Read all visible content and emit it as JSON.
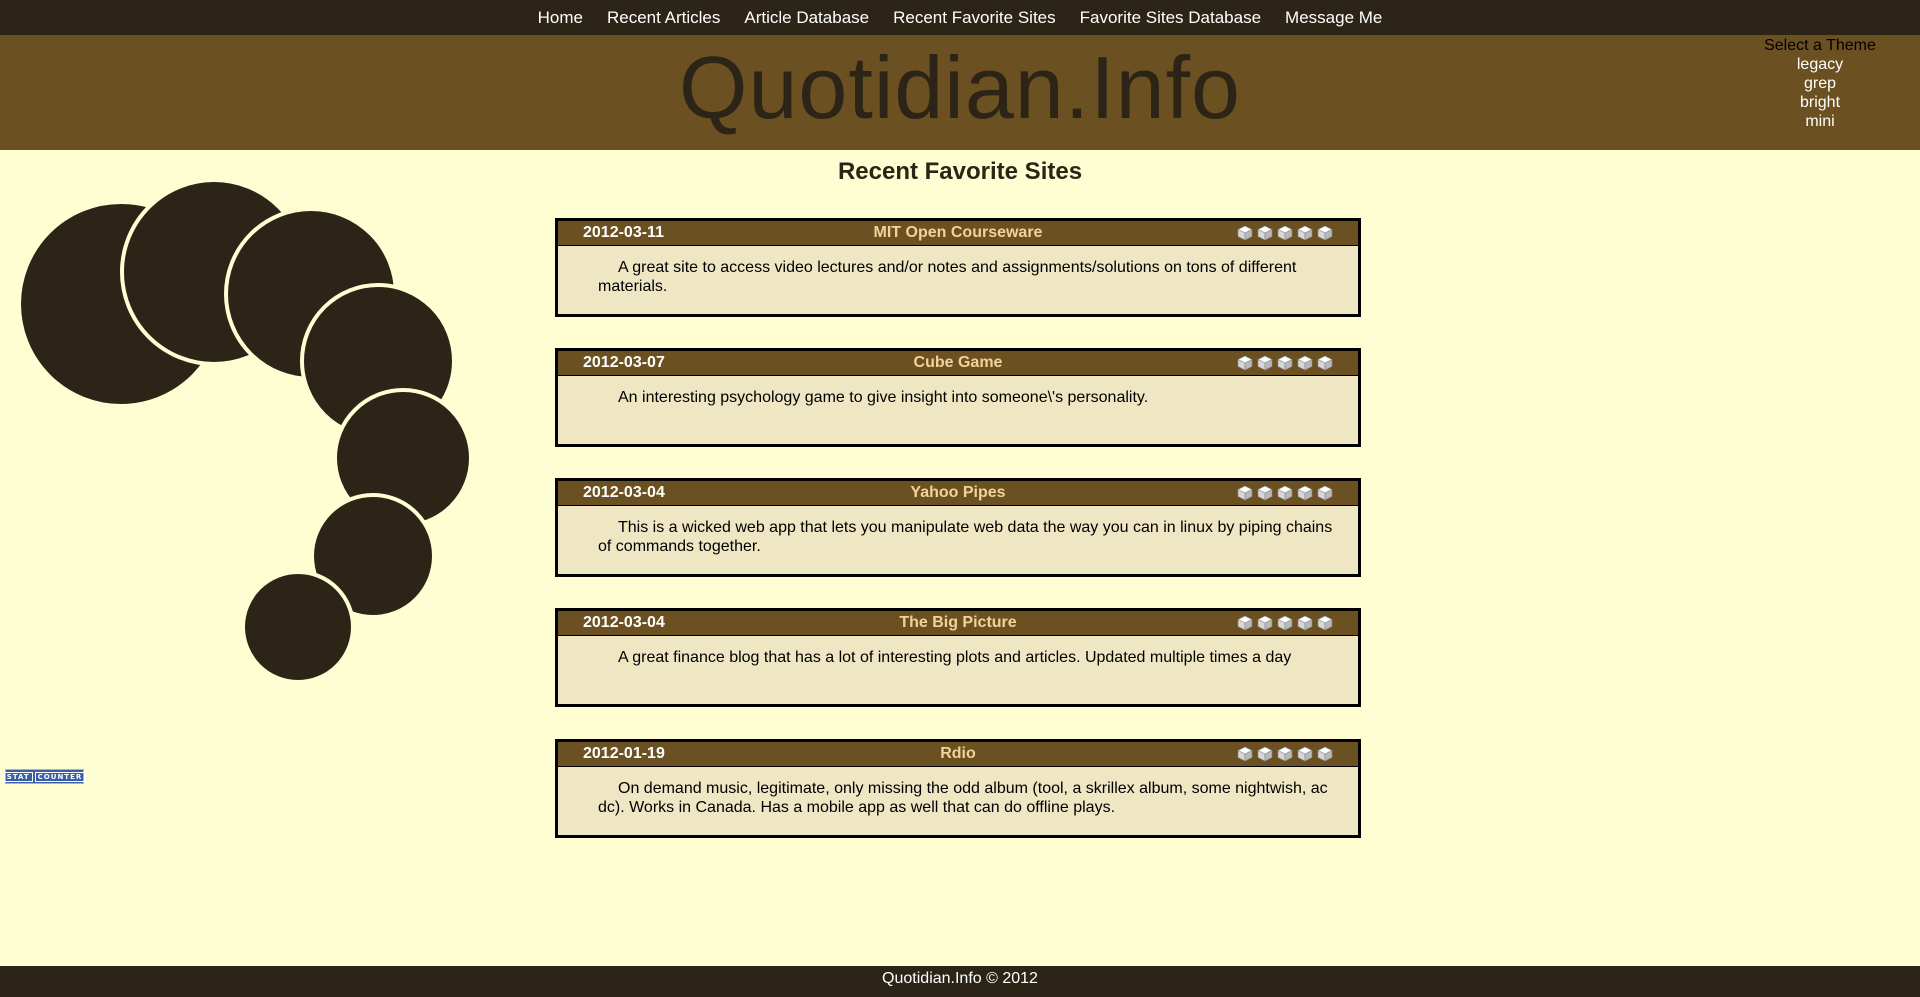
{
  "nav": {
    "items": [
      "Home",
      "Recent Articles",
      "Article Database",
      "Recent Favorite Sites",
      "Favorite Sites Database",
      "Message Me"
    ]
  },
  "header": {
    "site_title": "Quotidian.Info"
  },
  "theme_selector": {
    "heading": "Select a Theme",
    "options": [
      "legacy",
      "grep",
      "bright",
      "mini"
    ]
  },
  "page": {
    "heading": "Recent Favorite Sites"
  },
  "sites": [
    {
      "date": "2012-03-11",
      "title": "MIT Open Courseware",
      "rating": 5,
      "description": "A great site to access video lectures and/or notes and assignments/solutions on tons of different materials."
    },
    {
      "date": "2012-03-07",
      "title": "Cube Game",
      "rating": 5,
      "description": "An interesting psychology game to give insight into someone\\'s personality."
    },
    {
      "date": "2012-03-04",
      "title": "Yahoo Pipes",
      "rating": 5,
      "description": "This is a wicked web app that lets you manipulate web data the way you can in linux by piping chains of commands together."
    },
    {
      "date": "2012-03-04",
      "title": "The Big Picture",
      "rating": 5,
      "description": "A great finance blog that has a lot of interesting plots and articles. Updated multiple times a day"
    },
    {
      "date": "2012-01-19",
      "title": "Rdio",
      "rating": 5,
      "description": "On demand music, legitimate, only missing the odd album (tool, a skrillex album, some nightwish, ac dc). Works in Canada. Has a mobile app as well that can do offline plays."
    }
  ],
  "stat_badge": {
    "left": "STAT",
    "right": "COUNTER"
  },
  "footer": {
    "text": "Quotidian.Info © 2012"
  },
  "colors": {
    "background": "#fefed2",
    "dark": "#2c2416",
    "brown": "#6b5122",
    "card_body": "#efe6c4",
    "title_gold": "#f3d29a"
  }
}
